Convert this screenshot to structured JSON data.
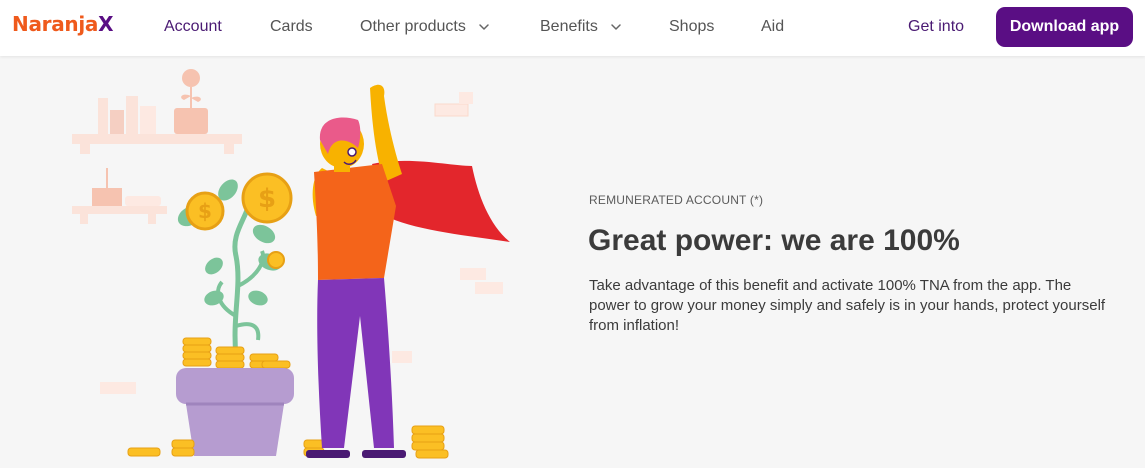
{
  "header": {
    "logo_main": "Naranja",
    "logo_x": "X",
    "nav": [
      {
        "label": "Account"
      },
      {
        "label": "Cards"
      },
      {
        "label": "Other products"
      },
      {
        "label": "Benefits"
      },
      {
        "label": "Shops"
      },
      {
        "label": "Aid"
      }
    ],
    "login_label": "Get into",
    "download_label": "Download app"
  },
  "hero": {
    "eyebrow": "REMUNERATED ACCOUNT (*)",
    "title": "Great power: we are 100%",
    "body": "Take advantage of this benefit and activate 100% TNA from the app. The power to grow your money simply and safely is in your hands, protect yourself from inflation!"
  },
  "colors": {
    "brand_orange": "#ef5a1c",
    "brand_purple": "#5a0e84",
    "active_nav": "#4a1a73"
  },
  "icons": [
    "chevron-down-icon"
  ]
}
